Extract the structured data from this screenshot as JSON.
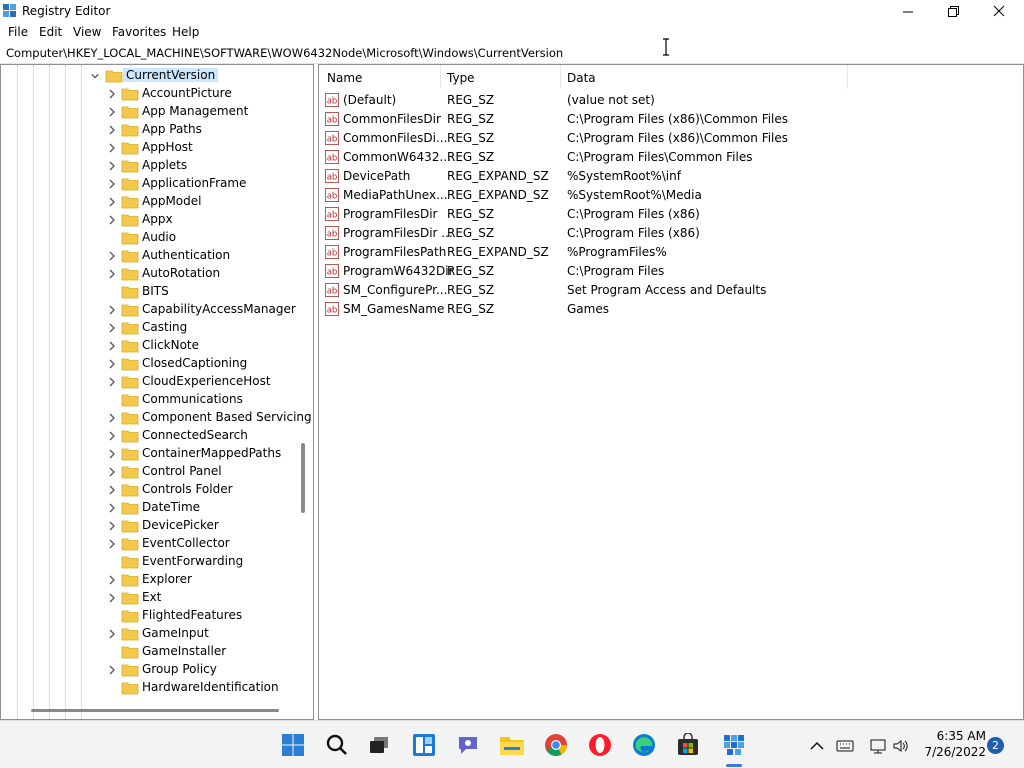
{
  "window": {
    "title": "Registry Editor"
  },
  "menu": [
    "File",
    "Edit",
    "View",
    "Favorites",
    "Help"
  ],
  "address": "Computer\\HKEY_LOCAL_MACHINE\\SOFTWARE\\WOW6432Node\\Microsoft\\Windows\\CurrentVersion",
  "tree": {
    "selected": "CurrentVersion",
    "children": [
      {
        "label": "AccountPicture",
        "expandable": true
      },
      {
        "label": "App Management",
        "expandable": true
      },
      {
        "label": "App Paths",
        "expandable": true
      },
      {
        "label": "AppHost",
        "expandable": true
      },
      {
        "label": "Applets",
        "expandable": true
      },
      {
        "label": "ApplicationFrame",
        "expandable": true
      },
      {
        "label": "AppModel",
        "expandable": true
      },
      {
        "label": "Appx",
        "expandable": true
      },
      {
        "label": "Audio",
        "expandable": false
      },
      {
        "label": "Authentication",
        "expandable": true
      },
      {
        "label": "AutoRotation",
        "expandable": true
      },
      {
        "label": "BITS",
        "expandable": false
      },
      {
        "label": "CapabilityAccessManager",
        "expandable": true
      },
      {
        "label": "Casting",
        "expandable": true
      },
      {
        "label": "ClickNote",
        "expandable": true
      },
      {
        "label": "ClosedCaptioning",
        "expandable": true
      },
      {
        "label": "CloudExperienceHost",
        "expandable": true
      },
      {
        "label": "Communications",
        "expandable": false
      },
      {
        "label": "Component Based Servicing",
        "expandable": true
      },
      {
        "label": "ConnectedSearch",
        "expandable": true
      },
      {
        "label": "ContainerMappedPaths",
        "expandable": true
      },
      {
        "label": "Control Panel",
        "expandable": true
      },
      {
        "label": "Controls Folder",
        "expandable": true
      },
      {
        "label": "DateTime",
        "expandable": true
      },
      {
        "label": "DevicePicker",
        "expandable": true
      },
      {
        "label": "EventCollector",
        "expandable": true
      },
      {
        "label": "EventForwarding",
        "expandable": false
      },
      {
        "label": "Explorer",
        "expandable": true
      },
      {
        "label": "Ext",
        "expandable": true
      },
      {
        "label": "FlightedFeatures",
        "expandable": false
      },
      {
        "label": "GameInput",
        "expandable": true
      },
      {
        "label": "GameInstaller",
        "expandable": false
      },
      {
        "label": "Group Policy",
        "expandable": true
      },
      {
        "label": "HardwareIdentification",
        "expandable": false
      }
    ]
  },
  "columns": [
    "Name",
    "Type",
    "Data"
  ],
  "values": [
    {
      "name": "(Default)",
      "type": "REG_SZ",
      "data": "(value not set)"
    },
    {
      "name": "CommonFilesDir",
      "type": "REG_SZ",
      "data": "C:\\Program Files (x86)\\Common Files"
    },
    {
      "name": "CommonFilesDi...",
      "type": "REG_SZ",
      "data": "C:\\Program Files (x86)\\Common Files"
    },
    {
      "name": "CommonW6432...",
      "type": "REG_SZ",
      "data": "C:\\Program Files\\Common Files"
    },
    {
      "name": "DevicePath",
      "type": "REG_EXPAND_SZ",
      "data": "%SystemRoot%\\inf"
    },
    {
      "name": "MediaPathUnex...",
      "type": "REG_EXPAND_SZ",
      "data": "%SystemRoot%\\Media"
    },
    {
      "name": "ProgramFilesDir",
      "type": "REG_SZ",
      "data": "C:\\Program Files (x86)"
    },
    {
      "name": "ProgramFilesDir ...",
      "type": "REG_SZ",
      "data": "C:\\Program Files (x86)"
    },
    {
      "name": "ProgramFilesPath",
      "type": "REG_EXPAND_SZ",
      "data": "%ProgramFiles%"
    },
    {
      "name": "ProgramW6432Dir",
      "type": "REG_SZ",
      "data": "C:\\Program Files"
    },
    {
      "name": "SM_ConfigurePr...",
      "type": "REG_SZ",
      "data": "Set Program Access and Defaults"
    },
    {
      "name": "SM_GamesName",
      "type": "REG_SZ",
      "data": "Games"
    }
  ],
  "taskbar": {
    "apps": [
      "start-icon",
      "search-icon",
      "task-view-icon",
      "widgets-icon",
      "chat-icon",
      "file-explorer-icon",
      "chrome-icon",
      "opera-icon",
      "edge-icon",
      "store-icon",
      "regedit-icon"
    ],
    "tray": [
      "chevron-up-icon",
      "keyboard-icon",
      "network-icon",
      "volume-icon"
    ],
    "time": "6:35 AM",
    "date": "7/26/2022",
    "notification_count": "2"
  },
  "colors": {
    "folder": "#f2c94c",
    "selection": "#cce8ff",
    "taskbar": "#f3f3f3"
  }
}
